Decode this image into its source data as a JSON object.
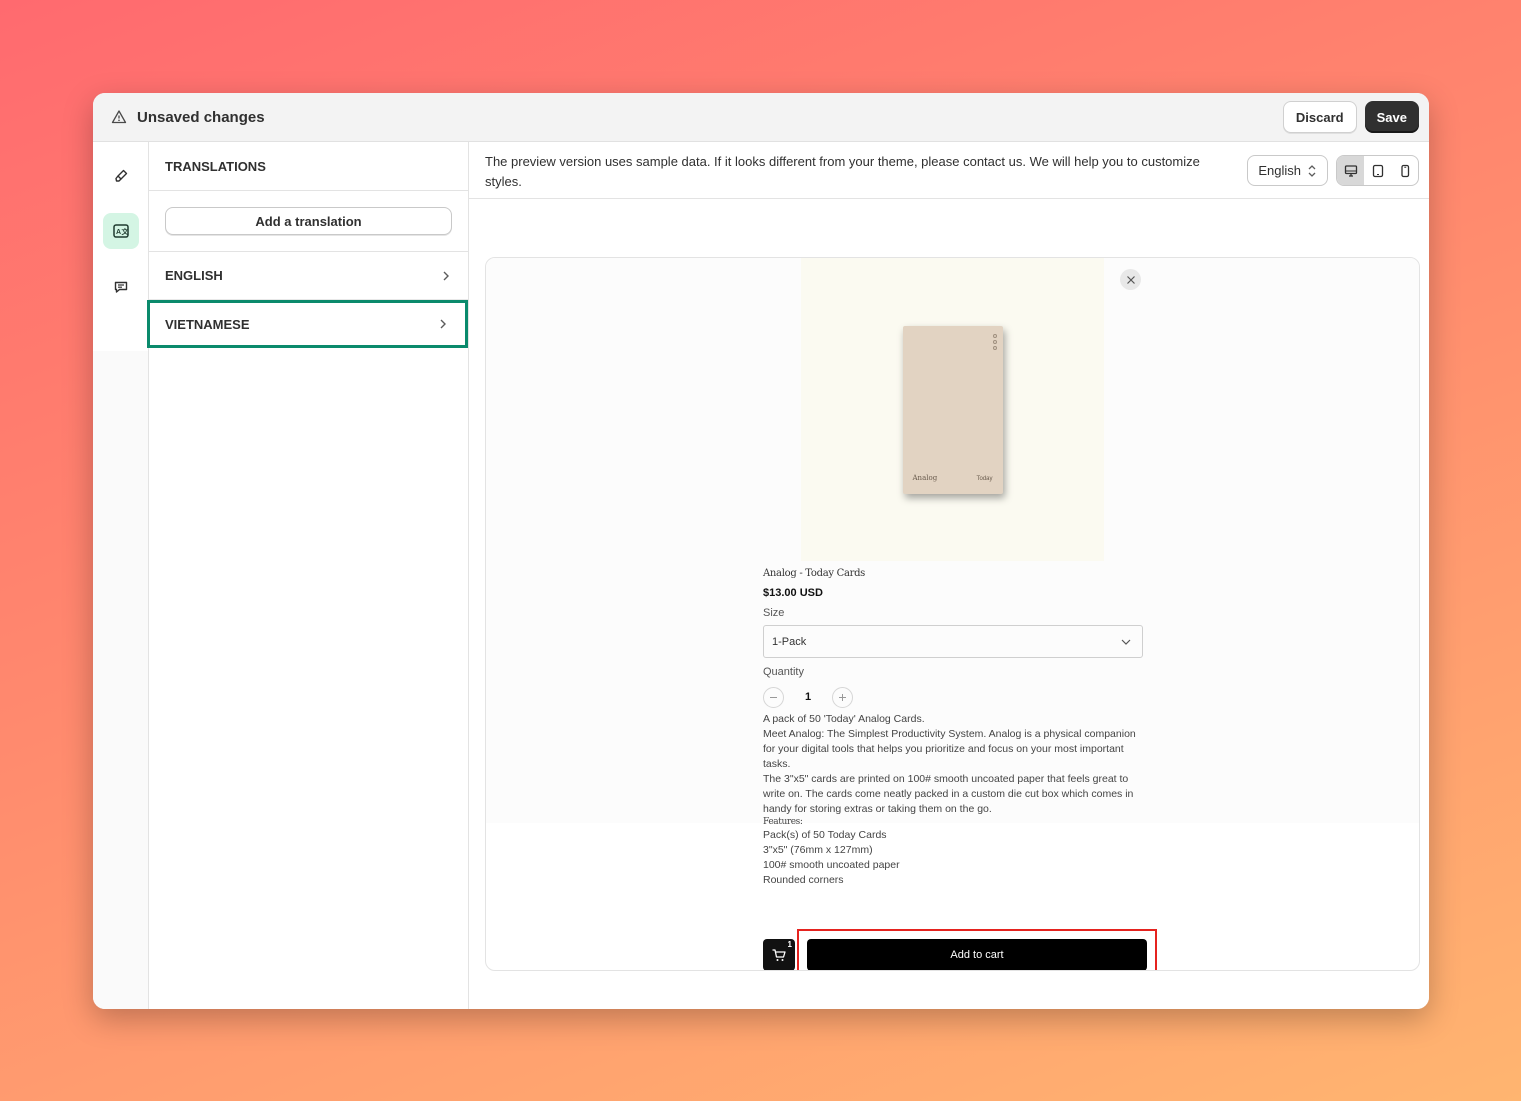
{
  "topbar": {
    "title": "Unsaved changes",
    "discard_label": "Discard",
    "save_label": "Save"
  },
  "rail": {
    "items": [
      {
        "icon": "paintbrush-icon"
      },
      {
        "icon": "translate-icon",
        "active": true
      },
      {
        "icon": "chat-icon"
      }
    ]
  },
  "panel": {
    "heading": "TRANSLATIONS",
    "add_label": "Add a translation",
    "languages": [
      {
        "label": "ENGLISH"
      },
      {
        "label": "VIETNAMESE",
        "selected": true
      }
    ]
  },
  "notice": {
    "message": "The preview version uses sample data. If it looks different from your theme, please contact us. We will help you to customize styles.",
    "language": "English"
  },
  "product": {
    "brand_on_box": "Analog",
    "sub_on_box": "Today",
    "title": "Analog - Today Cards",
    "price": "$13.00 USD",
    "size_label": "Size",
    "size_value": "1-Pack",
    "quantity_label": "Quantity",
    "quantity": "1",
    "description": [
      "A pack of 50 'Today' Analog Cards.",
      "Meet Analog: The Simplest Productivity System. Analog is a physical companion for your digital tools that helps you prioritize and focus on your most important tasks.",
      "The 3\"x5\" cards are printed on 100# smooth uncoated paper that feels great to write on. The cards come neatly packed in a custom die cut box which comes in handy for storing extras or taking them on the go."
    ],
    "features_label": "Features:",
    "features": [
      "Pack(s) of 50 Today Cards",
      "3\"x5\" (76mm x 127mm)",
      "100# smooth uncoated paper",
      "Rounded corners"
    ],
    "cart_count": "1",
    "add_to_cart_label": "Add to cart"
  },
  "colors": {
    "accent_selected": "#0a8a6c",
    "highlight_box": "#e5231f"
  }
}
